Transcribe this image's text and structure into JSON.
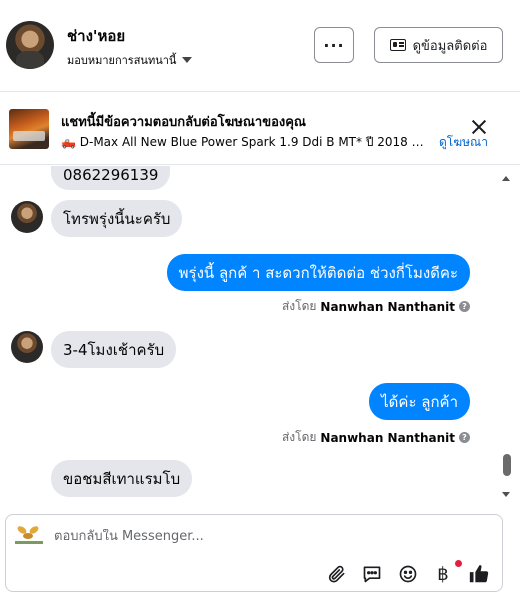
{
  "header": {
    "contact_name": "ช่าง'หอย",
    "assign_label": "มอบหมายการสนทนานี้",
    "more_label": "···",
    "view_contact_label": "ดูข้อมูลติดต่อ"
  },
  "ad_banner": {
    "title": "แชทนี้มีข้อความตอบกลับต่อโฆษณาของคุณ",
    "description": "🛻 D-Max All New Blue Power Spark 1.9 Ddi B MT* ปี 2018 🗓️ ปี : 2...",
    "link_label": "ดูโฆษณา"
  },
  "messages": [
    {
      "direction": "in",
      "text": "0862296139"
    },
    {
      "direction": "in",
      "text": "โทรพรุ่งนี้นะครับ"
    },
    {
      "direction": "out",
      "text": "พรุ่งนี้ ลูกค้ า สะดวกให้ติดต่อ ช่วงกี่โมงดีคะ"
    },
    {
      "direction": "in",
      "text": "3-4โมงเช้าครับ"
    },
    {
      "direction": "out",
      "text": "ได้ค่ะ  ลูกค้า"
    },
    {
      "direction": "in",
      "text": "ขอชมสีเทาแรมโบ"
    }
  ],
  "sent_by": {
    "prefix": "ส่งโดย",
    "name": "Nanwhan Nanthanit",
    "help": "?"
  },
  "composer": {
    "placeholder": "ตอบกลับใน Messenger..."
  },
  "icons": [
    "chevron-down-icon",
    "contact-card-icon",
    "close-icon",
    "help-icon",
    "attach-icon",
    "saved-reply-icon",
    "emoji-icon",
    "currency-icon",
    "like-icon"
  ],
  "colors": {
    "accent": "#0084ff",
    "incoming_bubble": "#e4e6eb",
    "link": "#0064d1",
    "notification_dot": "#e41e3f"
  }
}
